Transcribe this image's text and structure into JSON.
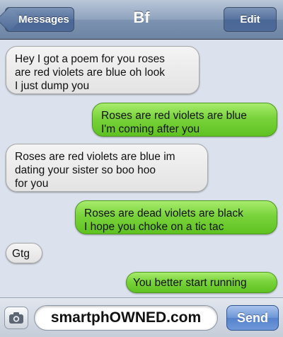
{
  "navbar": {
    "back_label": "Messages",
    "title": "Bf",
    "edit_label": "Edit"
  },
  "messages": [
    {
      "direction": "incoming",
      "text": "Hey I got a poem for you roses\nare red violets are blue oh look\nI just dump you"
    },
    {
      "direction": "outgoing",
      "text": "Roses are red violets are blue\nI'm coming after you"
    },
    {
      "direction": "incoming",
      "text": "Roses are red violets are blue im\ndating your sister so boo hoo\nfor you"
    },
    {
      "direction": "outgoing",
      "text": "Roses are dead violets are black\nI hope you choke on a tic tac"
    },
    {
      "direction": "incoming",
      "text": "Gtg"
    },
    {
      "direction": "outgoing",
      "text": "You better start running"
    }
  ],
  "input": {
    "value": "smartphOWNED.com",
    "send_label": "Send",
    "camera_icon": "camera-icon"
  },
  "colors": {
    "incoming_bubble": "#e6e6e6",
    "outgoing_bubble": "#79d33b",
    "nav_bar": "#8fa3be",
    "send_button": "#6c95d6"
  }
}
